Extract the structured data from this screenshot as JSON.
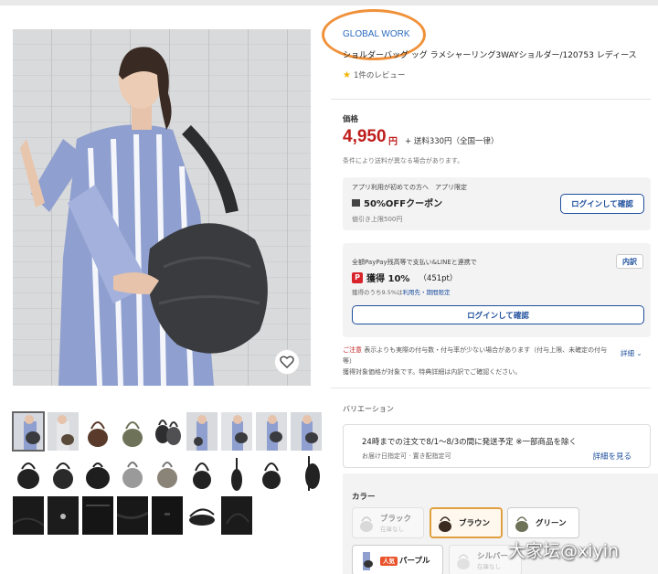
{
  "product": {
    "brand": "GLOBAL WORK",
    "title": "ショルダーバッグ ッグ ラメシャーリング3WAYショルダー/120753 レディース",
    "review_text": "1件のレビュー"
  },
  "price": {
    "label": "価格",
    "amount": "4,950",
    "currency": "円",
    "shipping": "+ 送料330円（全国一律）",
    "condition_note": "条件により送料が異なる場合があります。"
  },
  "coupon_card": {
    "header": "アプリ利用が初めての方へ　アプリ限定",
    "title": "50%OFFクーポン",
    "limit": "値引き上限500円",
    "login_button": "ログインして確認"
  },
  "points_card": {
    "header": "全額PayPay残高等で支払い&LINEと連携で",
    "breakdown_button": "内訳",
    "points_label": "獲得 10%",
    "points_value": "（451pt）",
    "sub_prefix": "獲得のうち9.5%は",
    "sub_link": "利用先・期間限定",
    "login_button": "ログインして確認"
  },
  "notice": {
    "warn": "ご注意",
    "text": "表示よりも実際の付与数・付与率が少ない場合があります（付与上限、未確定の付与等）",
    "detail_link": "詳細",
    "line2": "獲得対象価格が対象です。特典詳細は内訳でご確認ください。"
  },
  "variation": {
    "label": "バリエーション",
    "shipping_main": "24時までの注文で8/1〜8/3の間に発送予定 ※一部商品を除く",
    "shipping_sub": "お届け日指定可 · 置き配指定可",
    "shipping_link": "詳細を見る",
    "color_label": "カラー",
    "colors": [
      {
        "name": "ブラック",
        "status": "在庫なし"
      },
      {
        "name": "ブラウン",
        "status": ""
      },
      {
        "name": "グリーン",
        "status": ""
      },
      {
        "name": "パープル",
        "status": "",
        "badge": "人気"
      },
      {
        "name": "シルバー",
        "status": "在庫なし"
      }
    ]
  },
  "watermark": "大家坛@xiyin",
  "colors": {
    "brand": "#2a6bbf",
    "price": "#bf1c1c",
    "link": "#1e4f9c",
    "annotation": "#f0913a"
  }
}
